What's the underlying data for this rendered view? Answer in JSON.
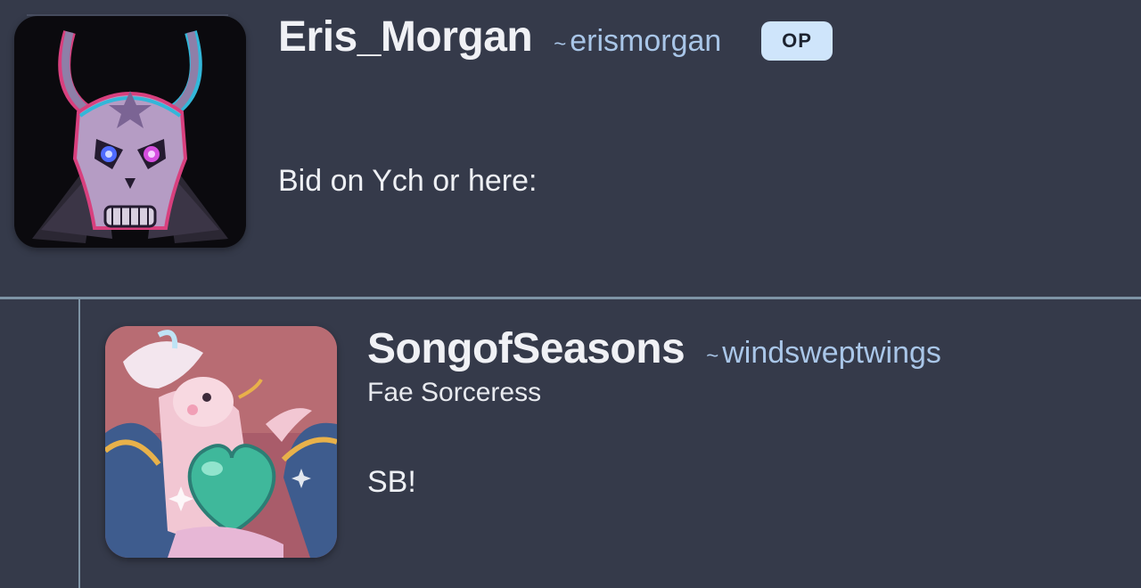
{
  "comments": [
    {
      "display_name": "Eris_Morgan",
      "username_prefix": "~",
      "username": "erismorgan",
      "badge": "OP",
      "text": "Bid on Ych or here:",
      "avatar": "demon-skull-avatar"
    },
    {
      "display_name": "SongofSeasons",
      "username_prefix": "~",
      "username": "windsweptwings",
      "title": "Fae Sorceress",
      "text": "SB!",
      "avatar": "fae-character-avatar"
    }
  ],
  "colors": {
    "background": "#353a4a",
    "display_name": "#f0f1f5",
    "username": "#a9c6e8",
    "badge_bg": "#cfe5fb",
    "badge_text": "#1d2330",
    "divider": "#7e93a5"
  }
}
